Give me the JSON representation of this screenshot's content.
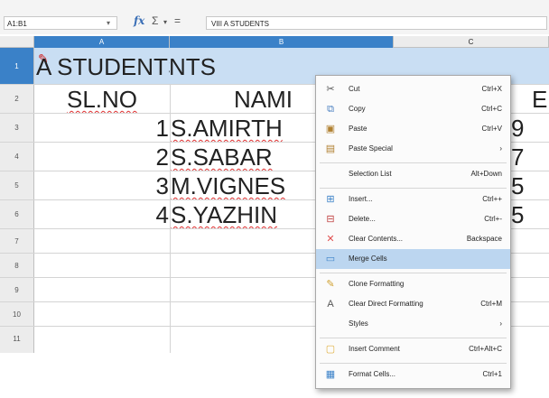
{
  "formula_bar": {
    "name_box": "A1:B1",
    "fx": "fx",
    "sigma": "Σ",
    "sigma_drop": "▾",
    "equals": "=",
    "input": "VIII A STUDENTS"
  },
  "columns": [
    "A",
    "B",
    "C"
  ],
  "rows": [
    {
      "num": "1",
      "a": "A STUDENTS",
      "b": "NTS"
    },
    {
      "num": "2",
      "a": "SL.NO",
      "b": "NAMI"
    },
    {
      "num": "3",
      "a": "1",
      "b": "S.AMIRTH"
    },
    {
      "num": "4",
      "a": "2",
      "b": "S.SABAR"
    },
    {
      "num": "5",
      "a": "3",
      "b": "M.VIGNES"
    },
    {
      "num": "6",
      "a": "4",
      "b": "S.YAZHIN"
    },
    {
      "num": "7",
      "a": "",
      "b": ""
    },
    {
      "num": "8",
      "a": "",
      "b": ""
    },
    {
      "num": "9",
      "a": "",
      "b": ""
    },
    {
      "num": "10",
      "a": "",
      "b": ""
    },
    {
      "num": "11",
      "a": "",
      "b": ""
    }
  ],
  "peek_c": [
    "E",
    "9",
    "7",
    "5",
    "5"
  ],
  "context_menu": {
    "items": [
      {
        "label": "Cut",
        "shortcut": "Ctrl+X",
        "icon": "scissors-icon"
      },
      {
        "label": "Copy",
        "shortcut": "Ctrl+C",
        "icon": "copy-icon"
      },
      {
        "label": "Paste",
        "shortcut": "Ctrl+V",
        "icon": "paste-icon"
      },
      {
        "label": "Paste Special",
        "shortcut": "›",
        "icon": "paste-special-icon"
      },
      {
        "label": "Selection List",
        "shortcut": "Alt+Down",
        "icon": ""
      },
      {
        "label": "Insert...",
        "shortcut": "Ctrl++",
        "icon": "insert-cells-icon"
      },
      {
        "label": "Delete...",
        "shortcut": "Ctrl+-",
        "icon": "delete-cells-icon"
      },
      {
        "label": "Clear Contents...",
        "shortcut": "Backspace",
        "icon": "clear-icon"
      },
      {
        "label": "Merge Cells",
        "shortcut": "",
        "icon": "merge-cells-icon"
      },
      {
        "label": "Clone Formatting",
        "shortcut": "",
        "icon": "clone-brush-icon"
      },
      {
        "label": "Clear Direct Formatting",
        "shortcut": "Ctrl+M",
        "icon": "clear-formatting-icon"
      },
      {
        "label": "Styles",
        "shortcut": "›",
        "icon": ""
      },
      {
        "label": "Insert Comment",
        "shortcut": "Ctrl+Alt+C",
        "icon": "comment-icon"
      },
      {
        "label": "Format Cells...",
        "shortcut": "Ctrl+1",
        "icon": "format-cells-icon"
      }
    ]
  },
  "colors": {
    "selection_header": "#3a81c8",
    "selection_fill": "#c9def3",
    "menu_highlight": "#bcd6f0"
  }
}
